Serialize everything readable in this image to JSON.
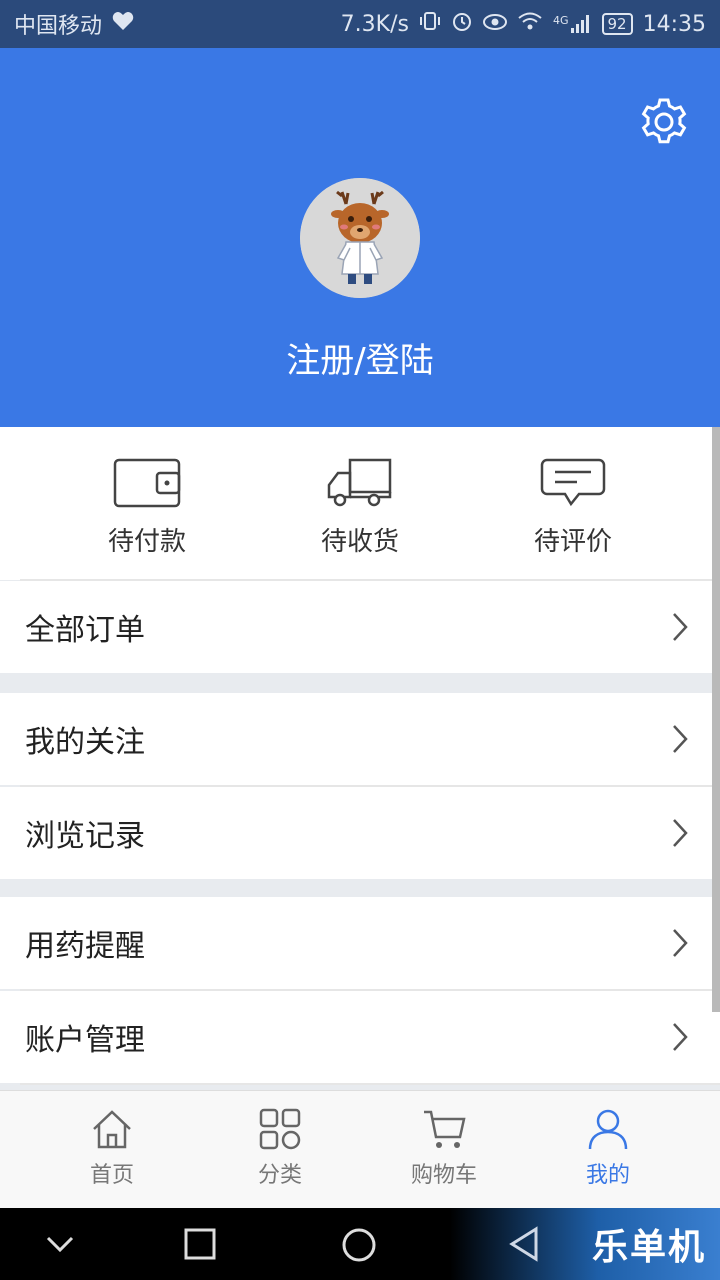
{
  "status_bar": {
    "carrier": "中国移动",
    "speed": "7.3K/s",
    "network": "4G",
    "battery": "92",
    "time": "14:35"
  },
  "header": {
    "login_label": "注册/登陆",
    "background_color": "#3a78e5"
  },
  "orders": {
    "items": [
      {
        "label": "待付款",
        "icon": "wallet-icon"
      },
      {
        "label": "待收货",
        "icon": "truck-icon"
      },
      {
        "label": "待评价",
        "icon": "comment-icon"
      }
    ]
  },
  "menu": {
    "all_orders": "全部订单",
    "my_follows": "我的关注",
    "browse_history": "浏览记录",
    "medication_reminder": "用药提醒",
    "account_management": "账户管理"
  },
  "tabbar": {
    "items": [
      {
        "label": "首页",
        "icon": "home-icon"
      },
      {
        "label": "分类",
        "icon": "category-icon"
      },
      {
        "label": "购物车",
        "icon": "cart-icon"
      },
      {
        "label": "我的",
        "icon": "user-icon",
        "active": true
      }
    ],
    "active_color": "#3a78e5"
  },
  "watermark": {
    "text": "乐单机"
  }
}
